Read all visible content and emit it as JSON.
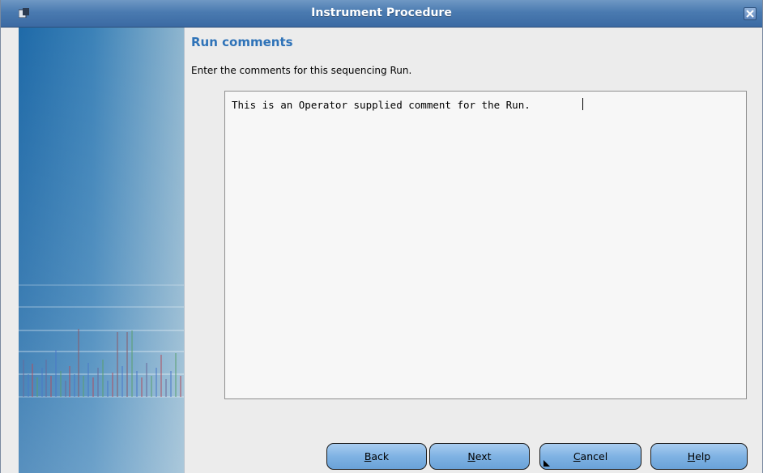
{
  "window": {
    "title": "Instrument Procedure"
  },
  "main": {
    "heading": "Run comments",
    "instructions": "Enter the comments for this sequencing Run.",
    "comment_value": "This is an Operator supplied comment for the Run."
  },
  "buttons": {
    "back": {
      "mnemonic": "B",
      "rest": "ack"
    },
    "next": {
      "mnemonic": "N",
      "rest": "ext"
    },
    "cancel": {
      "mnemonic": "C",
      "rest": "ancel"
    },
    "help": {
      "mnemonic": "H",
      "rest": "elp"
    }
  },
  "colors": {
    "titlebar": "#4a7ab0",
    "heading": "#2f73b8",
    "button": "#7fb2e3"
  }
}
